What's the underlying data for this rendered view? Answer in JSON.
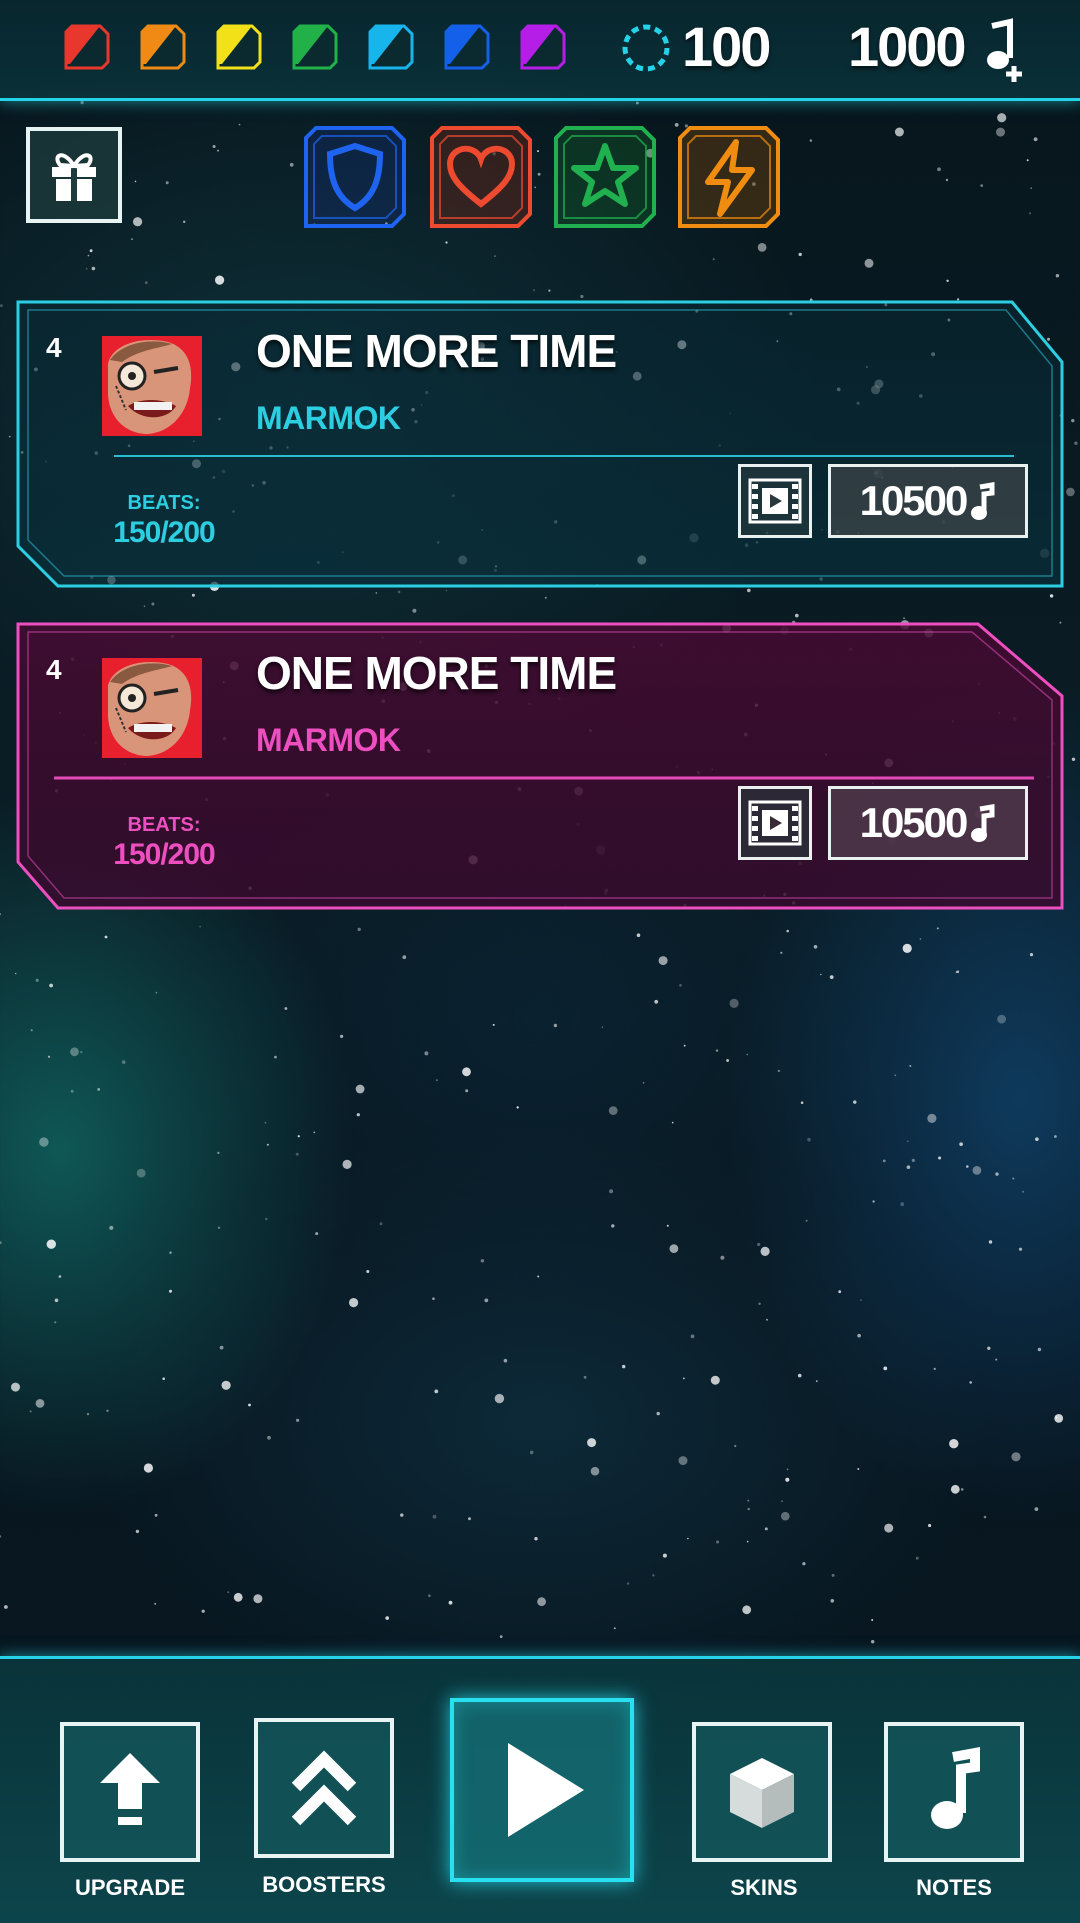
{
  "top_bar": {
    "gem_icons": [
      {
        "name": "red-gem-icon",
        "color": "#e8372c"
      },
      {
        "name": "orange-gem-icon",
        "color": "#f08a14"
      },
      {
        "name": "yellow-gem-icon",
        "color": "#f2e018"
      },
      {
        "name": "green-gem-icon",
        "color": "#22b048"
      },
      {
        "name": "cyan-gem-icon",
        "color": "#18b4ec"
      },
      {
        "name": "blue-gem-icon",
        "color": "#1460ea"
      },
      {
        "name": "purple-gem-icon",
        "color": "#b41ee6"
      }
    ],
    "energy_value": "100",
    "notes_value": "1000"
  },
  "boosters": [
    {
      "name": "shield-booster",
      "icon": "shield-icon",
      "color": "#1e64f0"
    },
    {
      "name": "heart-booster",
      "icon": "heart-icon",
      "color": "#ee4a30"
    },
    {
      "name": "star-booster",
      "icon": "star-icon",
      "color": "#20b050"
    },
    {
      "name": "lightning-booster",
      "icon": "lightning-icon",
      "color": "#f08c10"
    }
  ],
  "songs": [
    {
      "rank": "4",
      "title": "ONE MORE TIME",
      "artist": "MARMOK",
      "beats_label": "BEATS:",
      "beats_value": "150/200",
      "price": "10500",
      "accent": "#2ccfe2",
      "style": "cyan"
    },
    {
      "rank": "4",
      "title": "ONE MORE TIME",
      "artist": "MARMOK",
      "beats_label": "BEATS:",
      "beats_value": "150/200",
      "price": "10500",
      "accent": "#ee4fc0",
      "style": "magenta"
    }
  ],
  "bottom_nav": {
    "upgrade_label": "UPGRADE",
    "boosters_label": "BOOSTERS",
    "skins_label": "SKINS",
    "notes_label": "NOTES"
  },
  "colors": {
    "neon_cyan": "#25d3e8",
    "neon_magenta": "#ee4fc0",
    "frame_white": "#e8f4f4"
  }
}
